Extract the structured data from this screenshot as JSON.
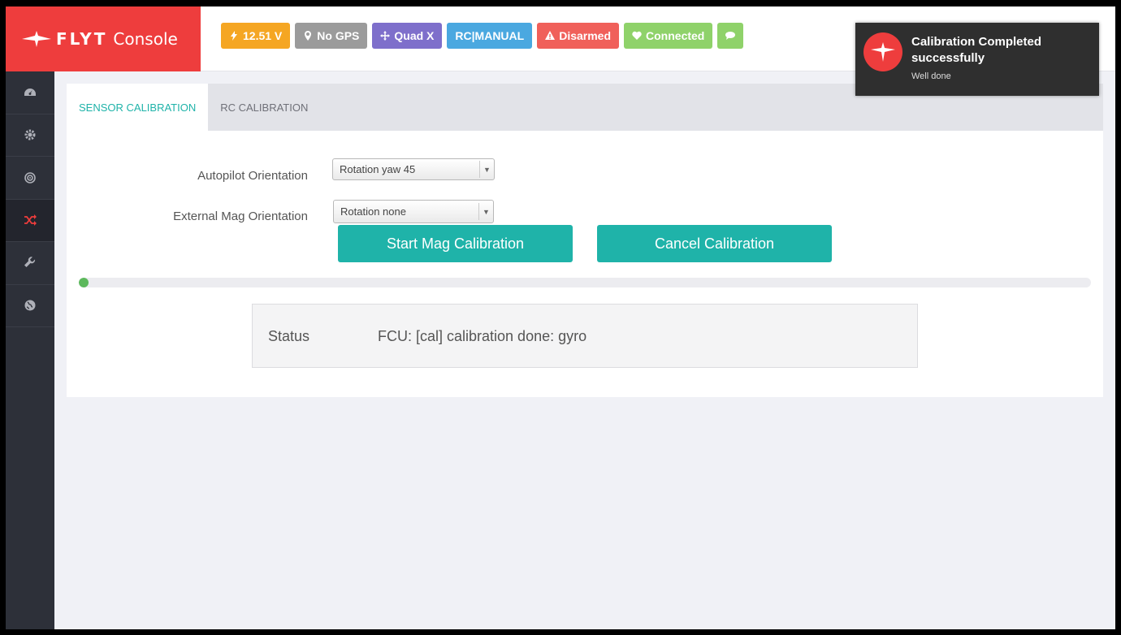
{
  "app": {
    "logo_text": "FLYT",
    "logo_text2": "Console"
  },
  "header": {
    "badges": [
      {
        "label": "12.51 V",
        "icon": "bolt-icon",
        "color": "#f5a623"
      },
      {
        "label": "No GPS",
        "icon": "map-marker-icon",
        "color": "#9b9b9b"
      },
      {
        "label": "Quad X",
        "icon": "move-arrows-icon",
        "color": "#7e6fcb"
      },
      {
        "label": "RC|MANUAL",
        "icon": "",
        "color": "#4aa8e0"
      },
      {
        "label": "Disarmed",
        "icon": "warning-icon",
        "color": "#f0605a"
      },
      {
        "label": "Connected",
        "icon": "heart-icon",
        "color": "#8fd26a"
      },
      {
        "label": "",
        "icon": "comments-icon",
        "color": "#8fd26a"
      }
    ]
  },
  "sidebar": {
    "items": [
      {
        "icon": "dashboard-icon",
        "active": false
      },
      {
        "icon": "gear-icon",
        "active": false
      },
      {
        "icon": "target-icon",
        "active": false
      },
      {
        "icon": "shuffle-icon",
        "active": true
      },
      {
        "icon": "wrench-icon",
        "active": false
      },
      {
        "icon": "globe-icon",
        "active": false
      }
    ]
  },
  "tabs": [
    {
      "label": "SENSOR CALIBRATION",
      "active": true
    },
    {
      "label": "RC CALIBRATION",
      "active": false
    }
  ],
  "form": {
    "autopilot_label": "Autopilot Orientation",
    "autopilot_value": "Rotation yaw 45",
    "extmag_label": "External Mag Orientation",
    "extmag_value": "Rotation none"
  },
  "buttons": {
    "start": "Start Mag Calibration",
    "cancel": "Cancel Calibration"
  },
  "progress": {
    "fraction": 0.01
  },
  "status": {
    "label": "Status",
    "text": "FCU: [cal] calibration done: gyro"
  },
  "toast": {
    "title": "Calibration Completed successfully",
    "message": "Well done"
  },
  "colors": {
    "brand": "#ee3d3d",
    "accent": "#1fb3a9",
    "sidebar": "#2d3039",
    "progress": "#5cb85c"
  }
}
